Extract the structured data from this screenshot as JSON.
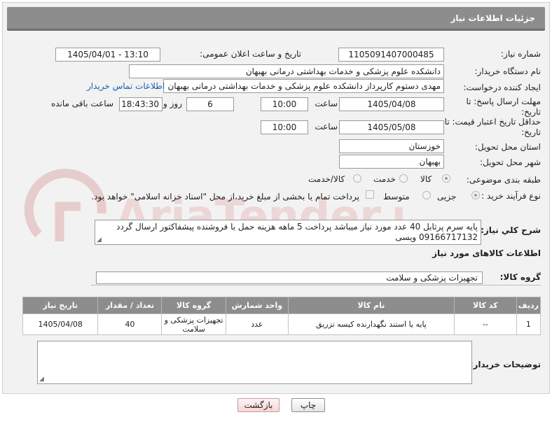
{
  "header": {
    "title": "جزئیات اطلاعات نیاز"
  },
  "form": {
    "need_number_label": "شماره نیاز:",
    "need_number": "1105091407000485",
    "announce_label": "تاریخ و ساعت اعلان عمومی:",
    "announce_value": "1405/04/01 - 13:10",
    "buyer_org_label": "نام دستگاه خریدار:",
    "buyer_org": "دانشکده علوم پزشکی و خدمات بهداشتی  درمانی بهبهان",
    "requester_label": "ایجاد کننده درخواست:",
    "requester": "مهدی دستوم کارپرداز دانشکده علوم پزشکی و خدمات بهداشتی  درمانی بهبهان",
    "contact_link": "اطلاعات تماس خریدار",
    "reply_deadline_label": "مهلت ارسال پاسخ: تا تاریخ:",
    "reply_date": "1405/04/08",
    "time_label": "ساعت",
    "reply_time": "10:00",
    "days_value": "6",
    "days_label": "روز و",
    "remaining_time": "18:43:30",
    "remaining_label": "ساعت باقی مانده",
    "price_validity_label": "حداقل تاریخ اعتبار قیمت: تا تاریخ:",
    "price_date": "1405/05/08",
    "price_time": "10:00",
    "province_label": "استان محل تحویل:",
    "province": "خوزستان",
    "city_label": "شهر محل تحویل:",
    "city": "بهبهان",
    "category_label": "طبقه بندی موضوعی:",
    "category_options": [
      "کالا",
      "خدمت",
      "کالا/خدمت"
    ],
    "process_label": "نوع فرآیند خرید :",
    "process_options": [
      "جزیی",
      "متوسط"
    ],
    "payment_note": "پرداخت تمام یا بخشی از مبلغ خرید،از محل \"اسناد خزانه اسلامی\" خواهد بود.",
    "description_label": "شرح کلي نياز:",
    "description": "پایه سرم پرتابل 40 عدد مورد نیاز میباشد پرداخت 5 ماهه هزینه حمل با فروشنده پیشفاکتور ارسال گردد 09166717132 ویسی"
  },
  "items_section": {
    "title": "اطلاعات کالاهای مورد نیاز",
    "group_label": "گروه کالا:",
    "group_value": "تجهیزات پزشکی و سلامت"
  },
  "table": {
    "headers": [
      "ردیف",
      "کد کالا",
      "نام کالا",
      "واحد شمارش",
      "گروه کالا",
      "تعداد / مقدار",
      "تاریخ نیاز"
    ],
    "rows": [
      [
        "1",
        "--",
        "پایه یا استند نگهدارنده کیسه تزریق",
        "عدد",
        "تجهیزات پزشکی و سلامت",
        "40",
        "1405/04/08"
      ]
    ]
  },
  "buyer_notes_label": "توضیحات خریدار:",
  "buttons": {
    "print": "چاپ",
    "back": "بازگشت"
  },
  "watermark": {
    "text": "AriaTender.net",
    "color": "#e4c4c4"
  }
}
